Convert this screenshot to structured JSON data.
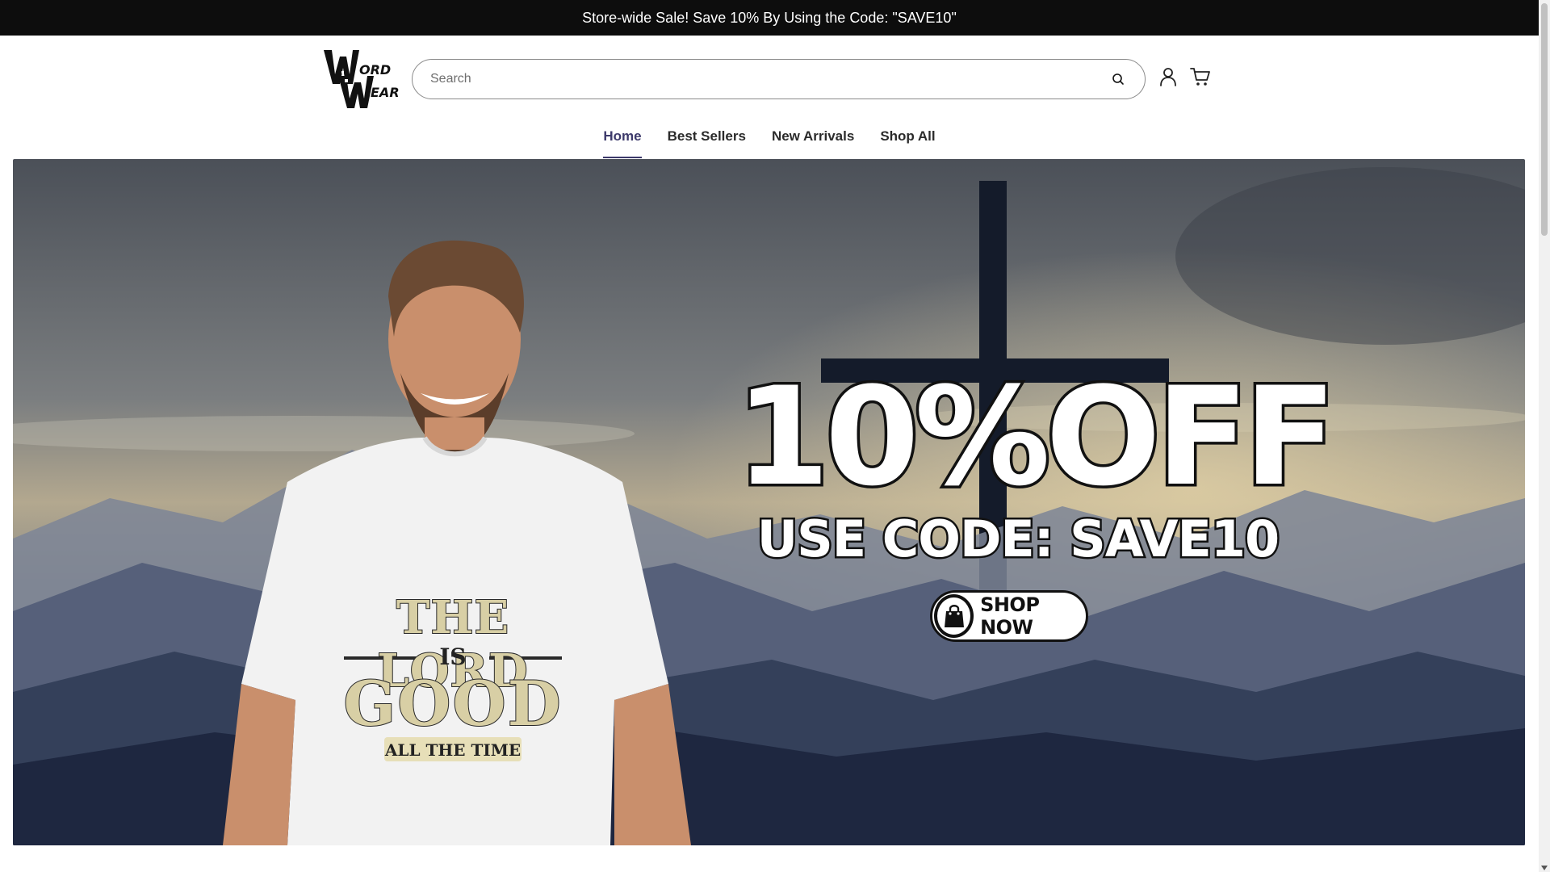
{
  "announcement": {
    "text": "Store-wide Sale! Save 10% By Using the Code: \"SAVE10\""
  },
  "header": {
    "logo_text": "Word Wear",
    "search": {
      "placeholder": "Search",
      "value": ""
    },
    "icons": [
      "search-icon",
      "account-icon",
      "cart-icon"
    ]
  },
  "nav": {
    "items": [
      {
        "label": "Home",
        "active": true
      },
      {
        "label": "Best Sellers",
        "active": false
      },
      {
        "label": "New Arrivals",
        "active": false
      },
      {
        "label": "Shop All",
        "active": false
      }
    ]
  },
  "hero": {
    "promo_title": "10%OFF",
    "promo_code": "USE CODE: SAVE10",
    "cta_label": "SHOP NOW",
    "shirt_text": {
      "line1": "THE LORD",
      "line2": "IS",
      "line3": "GOOD",
      "line4": "ALL THE TIME"
    }
  },
  "colors": {
    "nav_active": "#3d3a6b",
    "announce_bg": "#0d0d0d",
    "sky_top": "#4e535a",
    "mountain": "#1f2a40"
  }
}
